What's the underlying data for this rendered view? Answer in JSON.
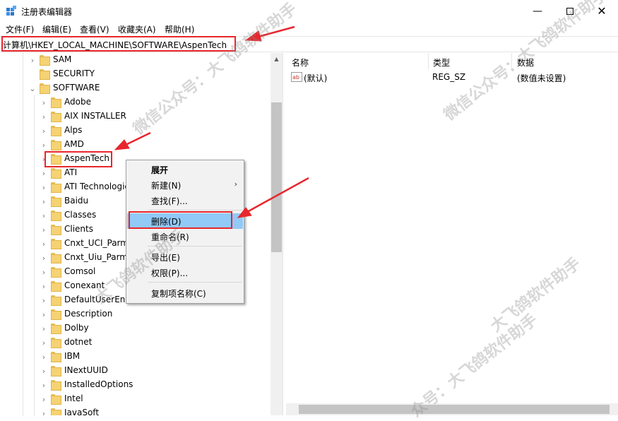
{
  "window": {
    "title": "注册表编辑器"
  },
  "menu": [
    "文件(F)",
    "编辑(E)",
    "查看(V)",
    "收藏夹(A)",
    "帮助(H)"
  ],
  "address": "计算机\\HKEY_LOCAL_MACHINE\\SOFTWARE\\AspenTech",
  "tree": {
    "top_items": [
      {
        "label": "SAM",
        "expanded": false
      },
      {
        "label": "SECURITY",
        "expanded": false
      },
      {
        "label": "SOFTWARE",
        "expanded": true
      }
    ],
    "software_children": [
      "Adobe",
      "AIX INSTALLER",
      "Alps",
      "AMD",
      "AspenTech",
      "ATI",
      "ATI Technologies",
      "Baidu",
      "Classes",
      "Clients",
      "Cnxt_UCI_Parms",
      "Cnxt_Uiu_Parms",
      "Comsol",
      "Conexant",
      "DefaultUserEnvironment",
      "Description",
      "Dolby",
      "dotnet",
      "IBM",
      "INextUUID",
      "InstalledOptions",
      "Intel",
      "JavaSoft"
    ],
    "selected": "AspenTech"
  },
  "list": {
    "columns": [
      "名称",
      "类型",
      "数据"
    ],
    "rows": [
      {
        "name": "(默认)",
        "type": "REG_SZ",
        "data": "(数值未设置)"
      }
    ]
  },
  "context_menu": {
    "items": [
      {
        "label": "展开",
        "bold": true
      },
      {
        "label": "新建(N)",
        "submenu": true
      },
      {
        "label": "查找(F)..."
      },
      {
        "label": "删除(D)",
        "highlighted": true
      },
      {
        "label": "重命名(R)"
      },
      {
        "label": "导出(E)"
      },
      {
        "label": "权限(P)..."
      },
      {
        "label": "复制项名称(C)"
      }
    ]
  },
  "watermarks": [
    "微信公众号：大飞鸽软件助手",
    "大飞鸽软件助手",
    "众号：大飞鸽软件助手"
  ],
  "colors": {
    "highlight_annotation": "#e8262c",
    "menu_highlight": "#91c9f7",
    "folder": "#f5d273"
  }
}
